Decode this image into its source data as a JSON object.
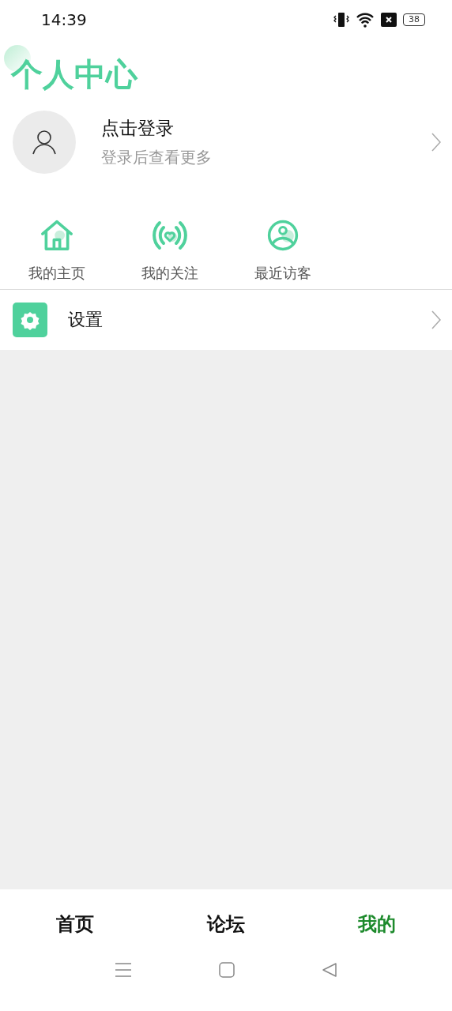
{
  "status_bar": {
    "time": "14:39",
    "battery": "38"
  },
  "title": "个人中心",
  "profile": {
    "name": "点击登录",
    "hint": "登录后查看更多"
  },
  "shortcuts": [
    {
      "kind": "home",
      "label": "我的主页"
    },
    {
      "kind": "follow",
      "label": "我的关注"
    },
    {
      "kind": "visitor",
      "label": "最近访客"
    }
  ],
  "menu": [
    {
      "kind": "settings",
      "label": "设置"
    }
  ],
  "tabs": [
    {
      "label": "首页",
      "selected": false
    },
    {
      "label": "论坛",
      "selected": false
    },
    {
      "label": "我的",
      "selected": true
    }
  ]
}
